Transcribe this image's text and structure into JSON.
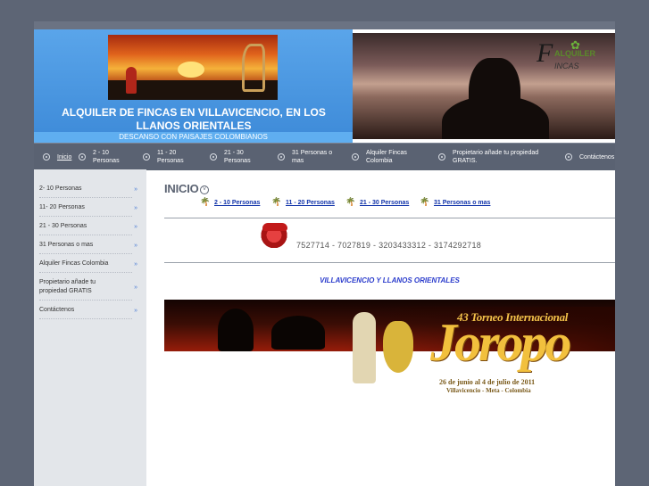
{
  "header": {
    "title": "ALQUILER DE FINCAS EN VILLAVICENCIO, EN LOS LLANOS ORIENTALES",
    "subtitle": "DESCANSO CON PAISAJES COLOMBIANOS",
    "logo_f": "F",
    "logo_top": "ALQUILER",
    "logo_bottom": "INCAS"
  },
  "nav": {
    "items": [
      {
        "label": "Inicio"
      },
      {
        "label": "2 - 10 Personas"
      },
      {
        "label": "11 - 20 Personas"
      },
      {
        "label": "21 - 30 Personas"
      },
      {
        "label": "31 Personas o mas"
      },
      {
        "label": "Alquiler Fincas Colombia"
      },
      {
        "label": "Propietario añade tu propiedad GRATIS."
      },
      {
        "label": "Contáctenos"
      }
    ]
  },
  "sidebar": {
    "arrow": "»",
    "items": [
      {
        "label": "2- 10 Personas"
      },
      {
        "label": "11- 20 Personas"
      },
      {
        "label": "21 - 30 Personas"
      },
      {
        "label": "31 Personas o mas"
      },
      {
        "label": "Alquiler Fincas Colombia"
      },
      {
        "label": "Propietario añade tu propiedad GRATIS"
      },
      {
        "label": "Contáctenos"
      }
    ]
  },
  "main": {
    "heading": "INICIO",
    "sublinks": [
      {
        "label": "2 - 10  Personas"
      },
      {
        "label": "11 - 20  Personas"
      },
      {
        "label": "21 - 30  Personas"
      },
      {
        "label": "31  Personas o mas"
      }
    ],
    "phones": "7527714  - 7027819 - 3203433312 - 3174292718",
    "subtitle": "VILLAVICENCIO Y LLANOS ORIENTALES"
  },
  "banner": {
    "torneo": "43 Torneo Internacional",
    "title": "Joropo",
    "fechas": "26 de junio al 4 de julio de 2011",
    "lugar": "Villavicencio - Meta - Colombia"
  }
}
